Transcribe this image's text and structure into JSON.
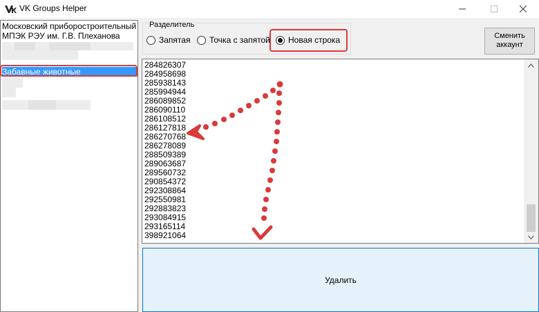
{
  "window": {
    "title": "VK Groups Helper"
  },
  "groups": {
    "items": [
      {
        "label": "Московский приборостроительный тех"
      },
      {
        "label": "МПЭК РЭУ им. Г.В. Плеханова"
      },
      {
        "label": "Забавные животные",
        "selected": true
      }
    ]
  },
  "separator": {
    "legend": "Разделитель",
    "options": [
      {
        "label": "Запятая",
        "checked": false
      },
      {
        "label": "Точка с запятой",
        "checked": false
      },
      {
        "label": "Новая строка",
        "checked": true
      }
    ]
  },
  "account": {
    "change_label_line1": "Сменить",
    "change_label_line2": "аккаунт"
  },
  "ids": [
    "284826307",
    "284958698",
    "285938143",
    "285994944",
    "286089852",
    "286090110",
    "286108512",
    "286127818",
    "286270768",
    "286278089",
    "288509389",
    "289063687",
    "289560732",
    "290854372",
    "292308864",
    "292550981",
    "292883823",
    "293084915",
    "293165114",
    "398921064"
  ],
  "actions": {
    "delete_label": "Удалить"
  },
  "colors": {
    "highlight": "#d93a3a",
    "selection": "#3399ff",
    "button_focus_border": "#0078d7"
  }
}
